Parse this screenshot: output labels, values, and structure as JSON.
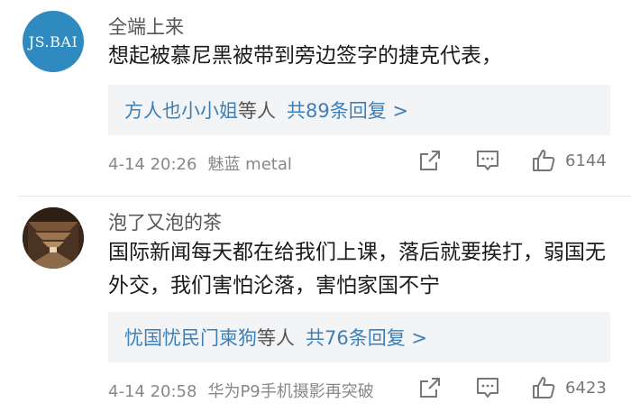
{
  "comments": [
    {
      "username": "全端上来",
      "avatar_text": "JS.BAI",
      "text": "想起被慕尼黑被带到旁边签字的捷克代表，",
      "reply_names": "方人也小小姐",
      "reply_mid": "等人",
      "reply_count": "共89条回复 >",
      "date": "4-14 20:26",
      "device": "魅蓝 metal",
      "likes": "6144"
    },
    {
      "username": "泡了又泡的茶",
      "text": "国际新闻每天都在给我们上课，落后就要挨打，弱国无外交，我们害怕沦落，害怕家国不宁",
      "reply_names": "忧国忧民门柬狗",
      "reply_mid": "等人",
      "reply_count": "共76条回复 >",
      "date": "4-14 20:58",
      "device": "华为P9手机摄影再突破",
      "likes": "6423"
    }
  ]
}
